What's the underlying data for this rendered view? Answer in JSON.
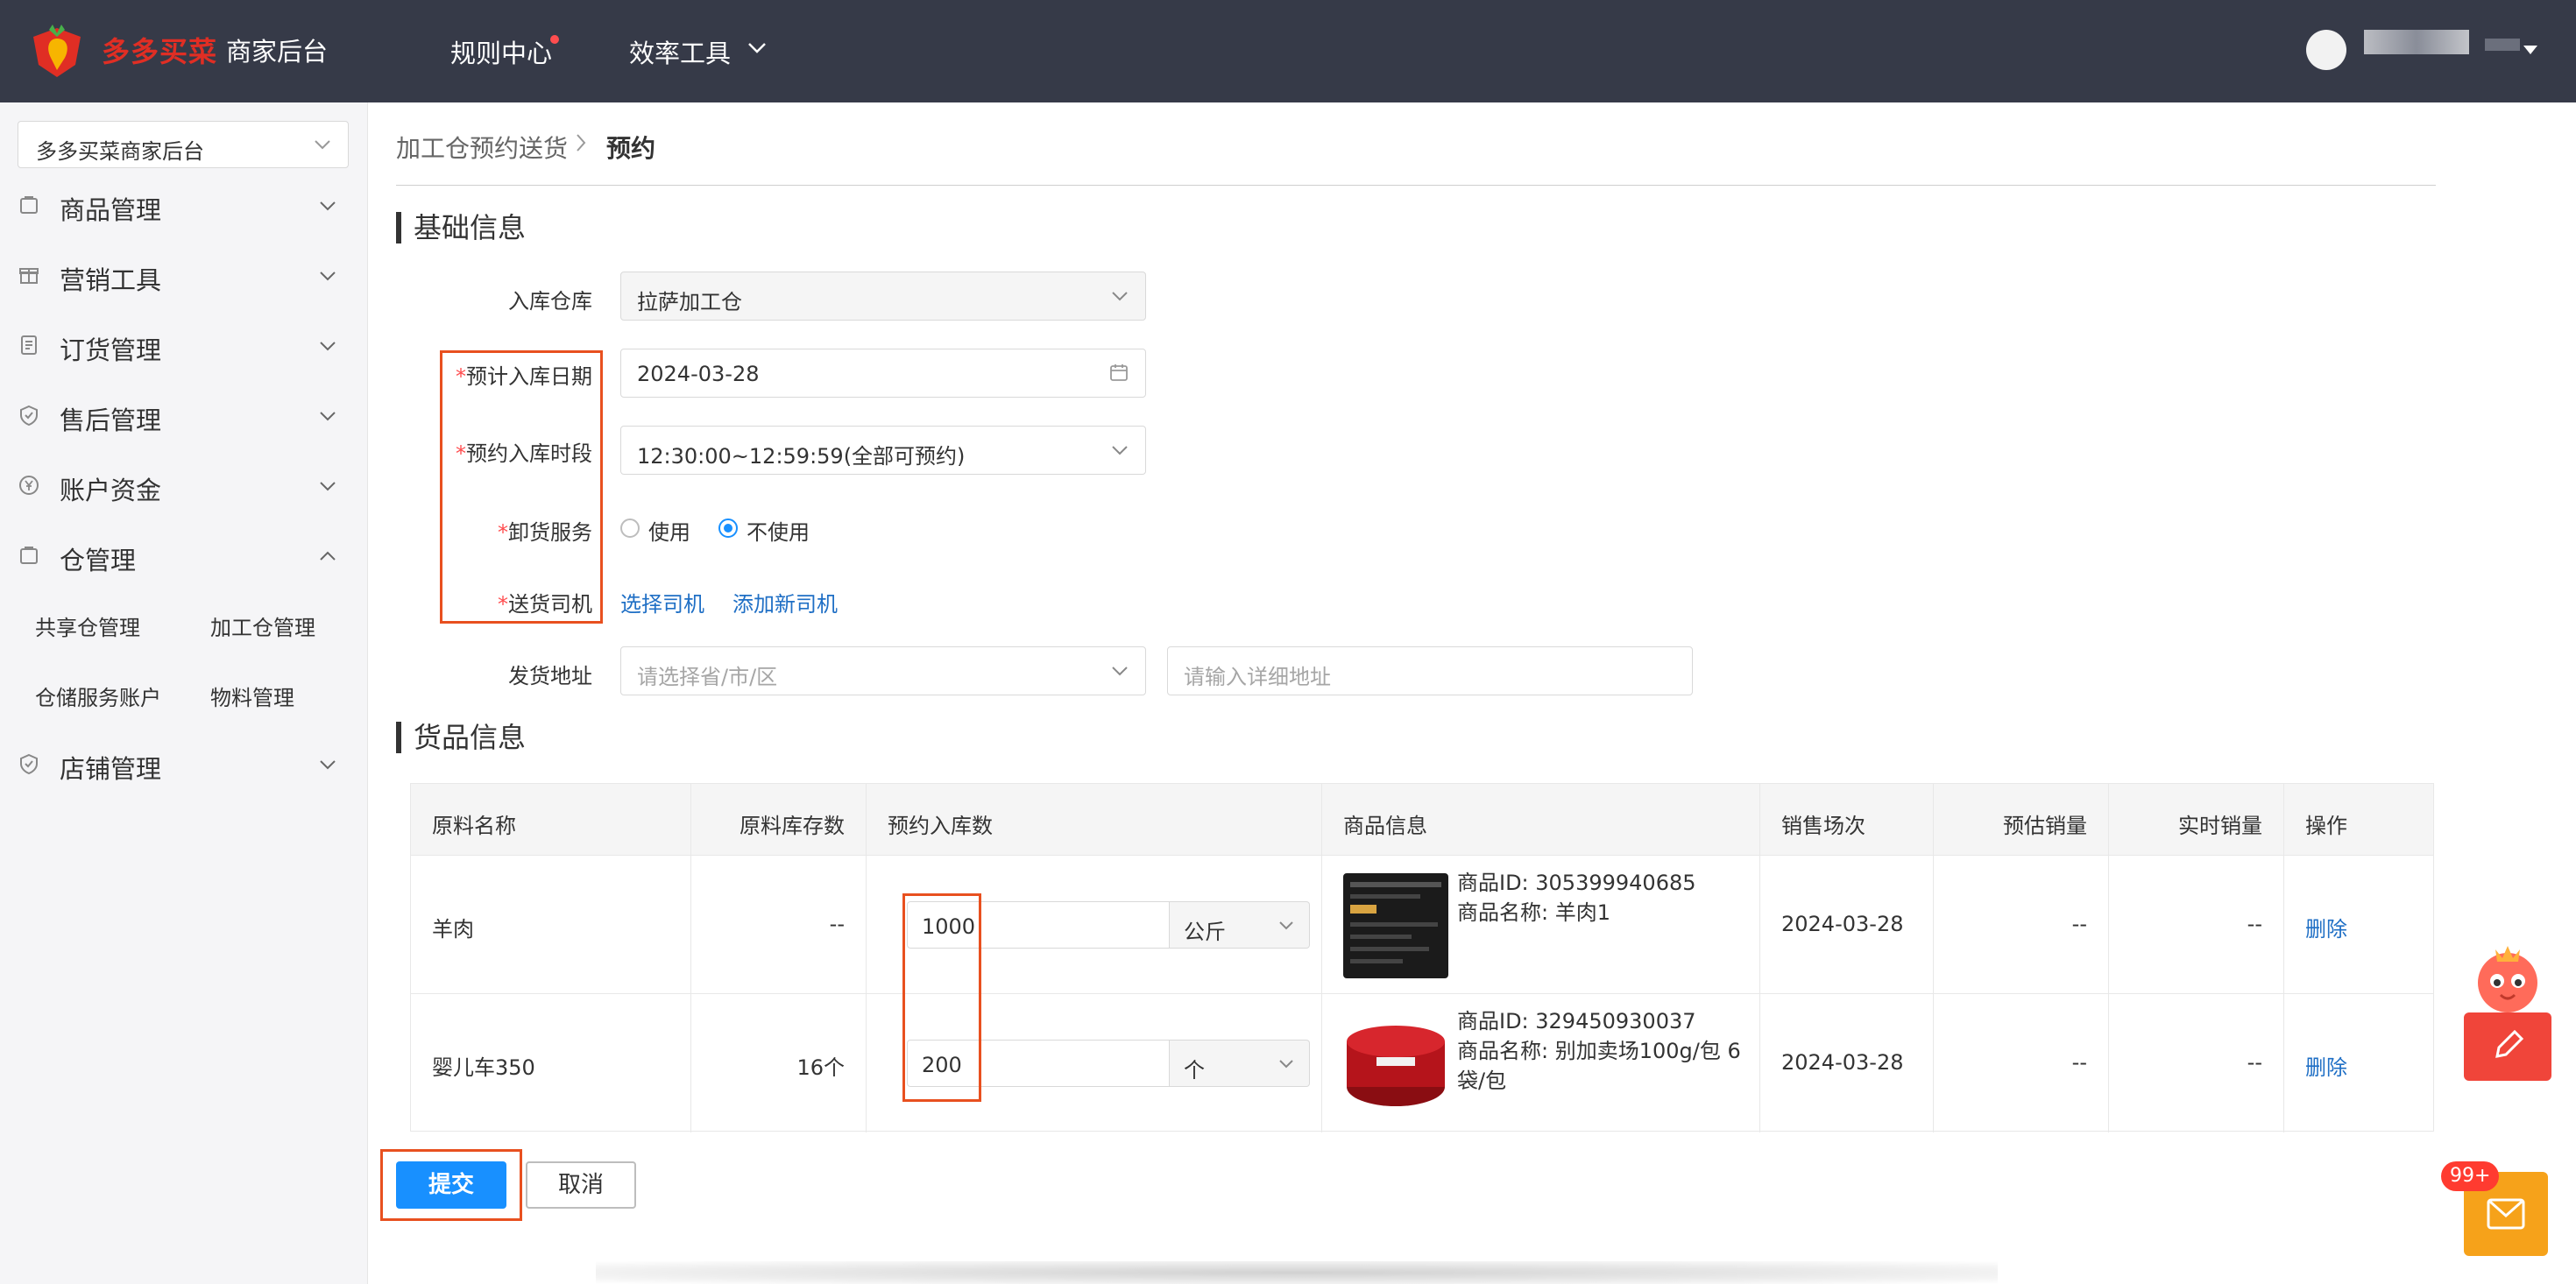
{
  "header": {
    "brand": "多多买菜",
    "brand_sub": "商家后台",
    "nav": [
      {
        "label": "规则中心"
      },
      {
        "label": "效率工具"
      }
    ]
  },
  "sidebar": {
    "shop_selector": "多多买菜商家后台",
    "menu": [
      {
        "label": "商品管理",
        "icon": "bag-icon"
      },
      {
        "label": "营销工具",
        "icon": "gift-icon"
      },
      {
        "label": "订货管理",
        "icon": "list-icon"
      },
      {
        "label": "售后管理",
        "icon": "shield-icon"
      },
      {
        "label": "账户资金",
        "icon": "yen-icon"
      },
      {
        "label": "仓管理",
        "icon": "bag-icon"
      },
      {
        "label": "店铺管理",
        "icon": "shield-icon"
      }
    ],
    "submenu": [
      "共享仓管理",
      "加工仓管理",
      "仓储服务账户",
      "物料管理"
    ]
  },
  "breadcrumb": {
    "parent": "加工仓预约送货",
    "current": "预约"
  },
  "basic": {
    "title": "基础信息",
    "warehouse_label": "入库仓库",
    "warehouse_value": "拉萨加工仓",
    "date_label": "预计入库日期",
    "date_value": "2024-03-28",
    "slot_label": "预约入库时段",
    "slot_value": "12:30:00~12:59:59(全部可预约)",
    "unload_label": "卸货服务",
    "unload_options": [
      "使用",
      "不使用"
    ],
    "unload_selected": "不使用",
    "driver_label": "送货司机",
    "driver_links": [
      "选择司机",
      "添加新司机"
    ],
    "address_label": "发货地址",
    "address_region_placeholder": "请选择省/市/区",
    "address_detail_placeholder": "请输入详细地址",
    "required_mark": "*"
  },
  "goods": {
    "title": "货品信息",
    "columns": [
      "原料名称",
      "原料库存数",
      "预约入库数",
      "商品信息",
      "销售场次",
      "预估销量",
      "实时销量",
      "操作"
    ],
    "rows": [
      {
        "name": "羊肉",
        "stock": "--",
        "qty": "1000",
        "unit": "公斤",
        "product_id": "商品ID: 305399940685",
        "product_name": "商品名称: 羊肉1",
        "session": "2024-03-28",
        "est_sales": "--",
        "real_sales": "--",
        "action": "删除"
      },
      {
        "name": "婴儿车350",
        "stock": "16个",
        "qty": "200",
        "unit": "个",
        "product_id": "商品ID: 329450930037",
        "product_name": "商品名称: 别加卖场100g/包 6袋/包",
        "session": "2024-03-28",
        "est_sales": "--",
        "real_sales": "--",
        "action": "删除"
      }
    ]
  },
  "actions": {
    "submit": "提交",
    "cancel": "取消"
  },
  "floating": {
    "badge": "99+"
  },
  "colors": {
    "accent": "#1890ff",
    "brand": "#e02e24",
    "header_bg": "#363a48",
    "highlight": "#e8501f",
    "link": "#1f6fc5"
  }
}
